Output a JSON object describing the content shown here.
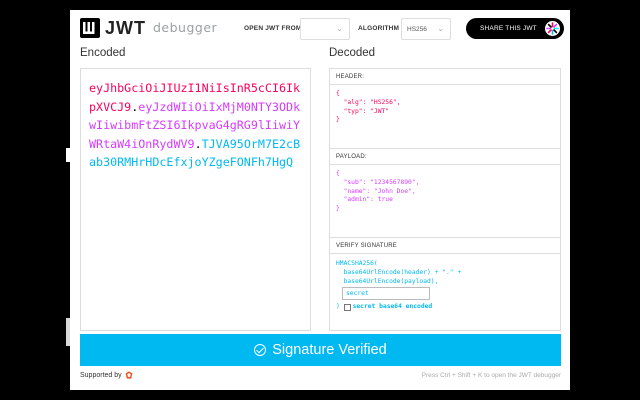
{
  "header": {
    "logo_text": "JWT",
    "logo_sub": "debugger",
    "open_from_label": "OPEN JWT FROM",
    "open_from_value": "",
    "algorithm_label": "ALGORITHM",
    "algorithm_value": "HS256",
    "share_label": "SHARE THIS JWT"
  },
  "encoded": {
    "title": "Encoded",
    "header_part": "eyJhbGciOiJIUzI1NiIsInR5cCI6IkpXVCJ9",
    "payload_part": "eyJzdWIiOiIxMjM0NTY3ODkwIiwibmFtZSI6IkpvaG4gRG9lIiwiYWRtaW4iOnRydWV9",
    "signature_part": "TJVA95OrM7E2cBab30RMHrHDcEfxjoYZgeFONFh7HgQ",
    "dot": "."
  },
  "decoded": {
    "title": "Decoded",
    "header_label": "HEADER:",
    "header_json": "{\n  \"alg\": \"HS256\",\n  \"typ\": \"JWT\"\n}",
    "payload_label": "PAYLOAD:",
    "payload_json": "{\n  \"sub\": \"1234567890\",\n  \"name\": \"John Doe\",\n  \"admin\": true\n}",
    "signature_label": "VERIFY SIGNATURE",
    "sig_line1": "HMACSHA256(",
    "sig_line2": "  base64UrlEncode(header) + \".\" +",
    "sig_line3": "  base64UrlEncode(payload),",
    "secret_value": "secret",
    "sig_close": ") ",
    "base64_label": "secret base64 encoded"
  },
  "status": {
    "verified_label": "Signature Verified"
  },
  "footer": {
    "supported_by": "Supported by",
    "shortcut_hint": "Press Ctrl + Shift + K to open the JWT debugger"
  },
  "colors": {
    "header": "#fb015b",
    "payload": "#d63aff",
    "signature": "#00b9f1"
  }
}
